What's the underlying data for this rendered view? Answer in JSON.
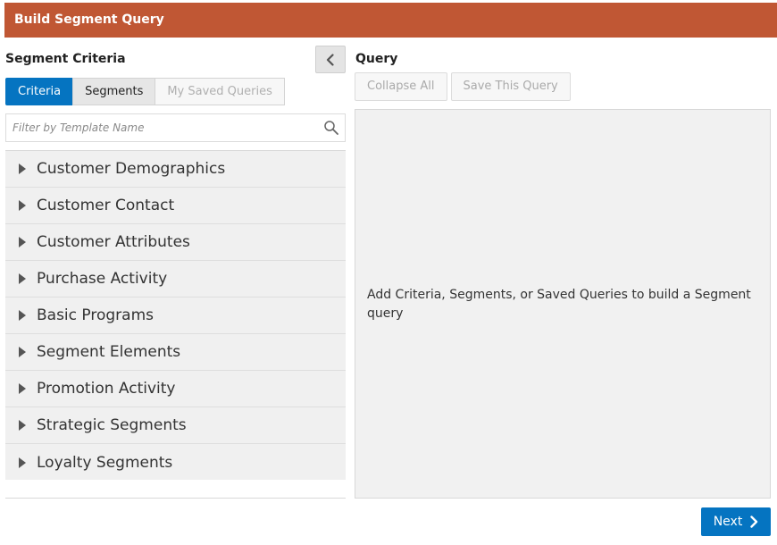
{
  "header": {
    "title": "Build Segment Query"
  },
  "left_panel": {
    "heading": "Segment Criteria",
    "tabs": [
      {
        "label": "Criteria",
        "state": "active"
      },
      {
        "label": "Segments",
        "state": "normal"
      },
      {
        "label": "My Saved Queries",
        "state": "disabled"
      }
    ],
    "filter": {
      "placeholder": "Filter by Template Name",
      "value": ""
    },
    "categories": [
      {
        "label": "Customer Demographics"
      },
      {
        "label": "Customer Contact"
      },
      {
        "label": "Customer Attributes"
      },
      {
        "label": "Purchase Activity"
      },
      {
        "label": "Basic Programs"
      },
      {
        "label": "Segment Elements"
      },
      {
        "label": "Promotion Activity"
      },
      {
        "label": "Strategic Segments"
      },
      {
        "label": "Loyalty Segments"
      }
    ]
  },
  "query_panel": {
    "heading": "Query",
    "toolbar": {
      "collapse_all": "Collapse All",
      "save_query": "Save This Query"
    },
    "empty_message": "Add Criteria, Segments, or Saved Queries to build a Segment query"
  },
  "footer": {
    "next_label": "Next"
  },
  "icons": {
    "collapse_panel": "chevron-left-icon",
    "search": "search-icon",
    "category_caret": "caret-right-icon",
    "next": "chevron-right-icon"
  },
  "colors": {
    "header_bg": "#c05734",
    "accent": "#0574c1",
    "panel_bg": "#f0f0f0"
  }
}
